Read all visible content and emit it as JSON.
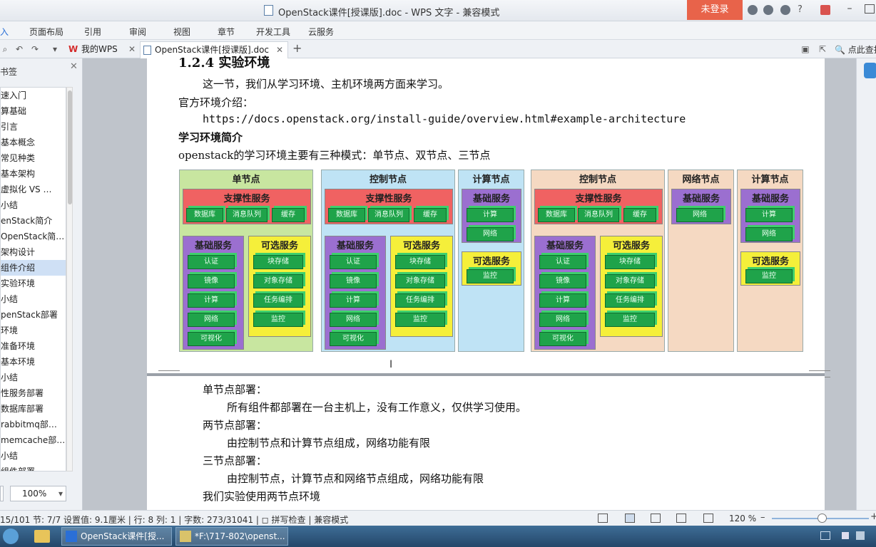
{
  "window": {
    "title": "OpenStack课件[授课版].doc - WPS 文字 - 兼容模式",
    "login": "未登录"
  },
  "ribbon": {
    "tabs": [
      "入",
      "页面布局",
      "引用",
      "审阅",
      "视图",
      "章节",
      "开发工具",
      "云服务"
    ]
  },
  "docbar": {
    "tab_wps": "我的WPS",
    "tab_doc": "OpenStack课件[授课版].doc",
    "find": "点此查找"
  },
  "leftpanel": {
    "title": "书签",
    "items": [
      "速入门",
      "算基础",
      "引言",
      "基本概念",
      "常见种类",
      "基本架构",
      "虚拟化 VS …",
      "小结",
      "enStack简介",
      "OpenStack简…",
      "架构设计",
      "组件介绍",
      "实验环境",
      "小结",
      "penStack部署",
      "环境",
      "准备环境",
      "基本环境",
      "小结",
      "性服务部署",
      "数据库部署",
      "rabbitmq部…",
      "memcache部…",
      "小结",
      "组件部署"
    ],
    "selected_index": 11,
    "zoom": "100%"
  },
  "doc": {
    "heading": "1.2.4 实验环境",
    "p1": "这一节，我们从学习环境、主机环境两方面来学习。",
    "p2": "官方环境介绍：",
    "url": "https://docs.openstack.org/install-guide/overview.html#example-architecture",
    "h_learn": "学习环境简介",
    "p3": "openstack的学习环境主要有三种模式：单节点、双节点、三节点",
    "s1": "单节点部署：",
    "s1d": "所有组件都部署在一台主机上，没有工作意义，仅供学习使用。",
    "s2": "两节点部署：",
    "s2d": "由控制节点和计算节点组成，网络功能有限",
    "s3": "三节点部署：",
    "s3d": "由控制节点，计算节点和网络节点组成，网络功能有限",
    "s4": "我们实验使用两节点环境"
  },
  "diagram": {
    "single": "单节点",
    "control": "控制节点",
    "compute": "计算节点",
    "network": "网络节点",
    "support": "支撑性服务",
    "basic": "基础服务",
    "optional": "可选服务",
    "db": "数据库",
    "mq": "消息队列",
    "cache": "缓存",
    "auth": "认证",
    "image": "镜像",
    "calc": "计算",
    "net": "网络",
    "viz": "可视化",
    "block": "块存储",
    "object": "对象存储",
    "orch": "任务编排",
    "mon": "监控",
    "colors": {
      "single_bg": "#c8e6a0",
      "control_bg": "#bfe3f5",
      "three_bg": "#f5d9c2",
      "support": "#f06262",
      "basic": "#9b6fd0",
      "optional": "#f5ef3a",
      "button": "#1fa34a"
    }
  },
  "status": {
    "text": "15/101  节: 7/7   设置值: 9.1厘米 | 行: 8  列: 1 |  字数: 273/31041 | ◻ 拼写检查 |   兼容模式",
    "zoom": "120 %"
  },
  "taskbar": {
    "task1": "OpenStack课件[授...",
    "task2": "*F:\\717-802\\openst..."
  }
}
